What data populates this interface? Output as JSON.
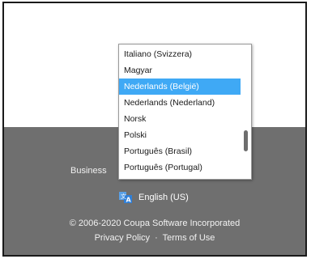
{
  "footer": {
    "business_text": "Business",
    "language_label": "English (US)",
    "language_icon": "translate-icon",
    "copyright": "© 2006-2020 Coupa Software Incorporated",
    "privacy_policy": "Privacy Policy",
    "separator": "·",
    "terms_of_use": "Terms of Use"
  },
  "language_dropdown": {
    "options": [
      "Italiano (Svizzera)",
      "Magyar",
      "Nederlands (België)",
      "Nederlands (Nederland)",
      "Norsk",
      "Polski",
      "Português (Brasil)",
      "Português (Portugal)"
    ],
    "selected": "Nederlands (België)"
  },
  "colors": {
    "footer_bg": "#6f6f6f",
    "highlight": "#3fa9f5",
    "icon_blue": "#2f7fd8"
  }
}
